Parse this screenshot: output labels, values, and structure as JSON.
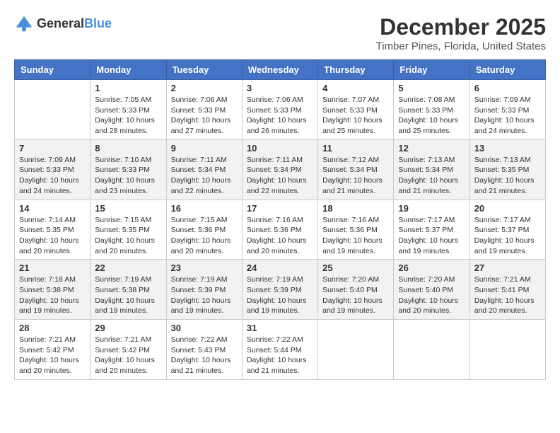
{
  "logo": {
    "general": "General",
    "blue": "Blue"
  },
  "title": {
    "month": "December 2025",
    "location": "Timber Pines, Florida, United States"
  },
  "headers": [
    "Sunday",
    "Monday",
    "Tuesday",
    "Wednesday",
    "Thursday",
    "Friday",
    "Saturday"
  ],
  "weeks": [
    [
      {
        "day": "",
        "sunrise": "",
        "sunset": "",
        "daylight": ""
      },
      {
        "day": "1",
        "sunrise": "Sunrise: 7:05 AM",
        "sunset": "Sunset: 5:33 PM",
        "daylight": "Daylight: 10 hours and 28 minutes."
      },
      {
        "day": "2",
        "sunrise": "Sunrise: 7:06 AM",
        "sunset": "Sunset: 5:33 PM",
        "daylight": "Daylight: 10 hours and 27 minutes."
      },
      {
        "day": "3",
        "sunrise": "Sunrise: 7:06 AM",
        "sunset": "Sunset: 5:33 PM",
        "daylight": "Daylight: 10 hours and 26 minutes."
      },
      {
        "day": "4",
        "sunrise": "Sunrise: 7:07 AM",
        "sunset": "Sunset: 5:33 PM",
        "daylight": "Daylight: 10 hours and 25 minutes."
      },
      {
        "day": "5",
        "sunrise": "Sunrise: 7:08 AM",
        "sunset": "Sunset: 5:33 PM",
        "daylight": "Daylight: 10 hours and 25 minutes."
      },
      {
        "day": "6",
        "sunrise": "Sunrise: 7:09 AM",
        "sunset": "Sunset: 5:33 PM",
        "daylight": "Daylight: 10 hours and 24 minutes."
      }
    ],
    [
      {
        "day": "7",
        "sunrise": "Sunrise: 7:09 AM",
        "sunset": "Sunset: 5:33 PM",
        "daylight": "Daylight: 10 hours and 24 minutes."
      },
      {
        "day": "8",
        "sunrise": "Sunrise: 7:10 AM",
        "sunset": "Sunset: 5:33 PM",
        "daylight": "Daylight: 10 hours and 23 minutes."
      },
      {
        "day": "9",
        "sunrise": "Sunrise: 7:11 AM",
        "sunset": "Sunset: 5:34 PM",
        "daylight": "Daylight: 10 hours and 22 minutes."
      },
      {
        "day": "10",
        "sunrise": "Sunrise: 7:11 AM",
        "sunset": "Sunset: 5:34 PM",
        "daylight": "Daylight: 10 hours and 22 minutes."
      },
      {
        "day": "11",
        "sunrise": "Sunrise: 7:12 AM",
        "sunset": "Sunset: 5:34 PM",
        "daylight": "Daylight: 10 hours and 21 minutes."
      },
      {
        "day": "12",
        "sunrise": "Sunrise: 7:13 AM",
        "sunset": "Sunset: 5:34 PM",
        "daylight": "Daylight: 10 hours and 21 minutes."
      },
      {
        "day": "13",
        "sunrise": "Sunrise: 7:13 AM",
        "sunset": "Sunset: 5:35 PM",
        "daylight": "Daylight: 10 hours and 21 minutes."
      }
    ],
    [
      {
        "day": "14",
        "sunrise": "Sunrise: 7:14 AM",
        "sunset": "Sunset: 5:35 PM",
        "daylight": "Daylight: 10 hours and 20 minutes."
      },
      {
        "day": "15",
        "sunrise": "Sunrise: 7:15 AM",
        "sunset": "Sunset: 5:35 PM",
        "daylight": "Daylight: 10 hours and 20 minutes."
      },
      {
        "day": "16",
        "sunrise": "Sunrise: 7:15 AM",
        "sunset": "Sunset: 5:36 PM",
        "daylight": "Daylight: 10 hours and 20 minutes."
      },
      {
        "day": "17",
        "sunrise": "Sunrise: 7:16 AM",
        "sunset": "Sunset: 5:36 PM",
        "daylight": "Daylight: 10 hours and 20 minutes."
      },
      {
        "day": "18",
        "sunrise": "Sunrise: 7:16 AM",
        "sunset": "Sunset: 5:36 PM",
        "daylight": "Daylight: 10 hours and 19 minutes."
      },
      {
        "day": "19",
        "sunrise": "Sunrise: 7:17 AM",
        "sunset": "Sunset: 5:37 PM",
        "daylight": "Daylight: 10 hours and 19 minutes."
      },
      {
        "day": "20",
        "sunrise": "Sunrise: 7:17 AM",
        "sunset": "Sunset: 5:37 PM",
        "daylight": "Daylight: 10 hours and 19 minutes."
      }
    ],
    [
      {
        "day": "21",
        "sunrise": "Sunrise: 7:18 AM",
        "sunset": "Sunset: 5:38 PM",
        "daylight": "Daylight: 10 hours and 19 minutes."
      },
      {
        "day": "22",
        "sunrise": "Sunrise: 7:19 AM",
        "sunset": "Sunset: 5:38 PM",
        "daylight": "Daylight: 10 hours and 19 minutes."
      },
      {
        "day": "23",
        "sunrise": "Sunrise: 7:19 AM",
        "sunset": "Sunset: 5:39 PM",
        "daylight": "Daylight: 10 hours and 19 minutes."
      },
      {
        "day": "24",
        "sunrise": "Sunrise: 7:19 AM",
        "sunset": "Sunset: 5:39 PM",
        "daylight": "Daylight: 10 hours and 19 minutes."
      },
      {
        "day": "25",
        "sunrise": "Sunrise: 7:20 AM",
        "sunset": "Sunset: 5:40 PM",
        "daylight": "Daylight: 10 hours and 19 minutes."
      },
      {
        "day": "26",
        "sunrise": "Sunrise: 7:20 AM",
        "sunset": "Sunset: 5:40 PM",
        "daylight": "Daylight: 10 hours and 20 minutes."
      },
      {
        "day": "27",
        "sunrise": "Sunrise: 7:21 AM",
        "sunset": "Sunset: 5:41 PM",
        "daylight": "Daylight: 10 hours and 20 minutes."
      }
    ],
    [
      {
        "day": "28",
        "sunrise": "Sunrise: 7:21 AM",
        "sunset": "Sunset: 5:42 PM",
        "daylight": "Daylight: 10 hours and 20 minutes."
      },
      {
        "day": "29",
        "sunrise": "Sunrise: 7:21 AM",
        "sunset": "Sunset: 5:42 PM",
        "daylight": "Daylight: 10 hours and 20 minutes."
      },
      {
        "day": "30",
        "sunrise": "Sunrise: 7:22 AM",
        "sunset": "Sunset: 5:43 PM",
        "daylight": "Daylight: 10 hours and 21 minutes."
      },
      {
        "day": "31",
        "sunrise": "Sunrise: 7:22 AM",
        "sunset": "Sunset: 5:44 PM",
        "daylight": "Daylight: 10 hours and 21 minutes."
      },
      {
        "day": "",
        "sunrise": "",
        "sunset": "",
        "daylight": ""
      },
      {
        "day": "",
        "sunrise": "",
        "sunset": "",
        "daylight": ""
      },
      {
        "day": "",
        "sunrise": "",
        "sunset": "",
        "daylight": ""
      }
    ]
  ]
}
